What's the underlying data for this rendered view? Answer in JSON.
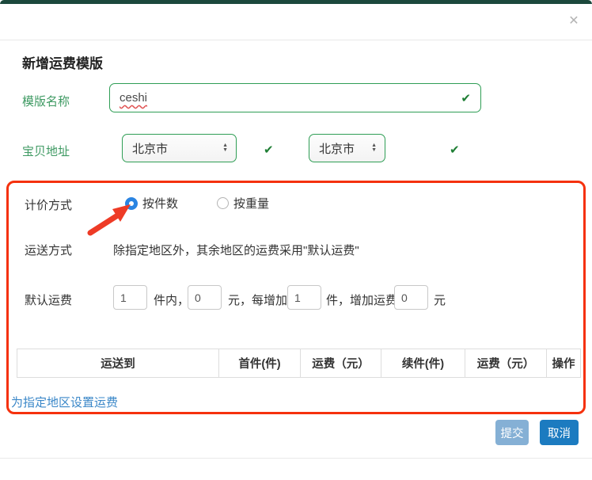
{
  "modal": {
    "title": "新增运费模版",
    "form": {
      "template_name": {
        "label": "模版名称",
        "value": "ceshi"
      },
      "item_address": {
        "label": "宝贝地址",
        "province": "北京市",
        "city": "北京市"
      },
      "pricing_method": {
        "label": "计价方式",
        "options": [
          {
            "label": "按件数",
            "selected": true
          },
          {
            "label": "按重量",
            "selected": false
          }
        ]
      },
      "shipping_method": {
        "label": "运送方式",
        "note": "除指定地区外，其余地区的运费采用\"默认运费\""
      },
      "default_fee": {
        "label": "默认运费",
        "within_count": "1",
        "t1": "件内，",
        "base_fee": "0",
        "t2": "元，每增加",
        "increment_count": "1",
        "t3": "件，增加运费",
        "increment_fee": "0",
        "t4": "元"
      }
    },
    "table": {
      "headers": [
        "运送到",
        "首件(件)",
        "运费（元）",
        "续件(件)",
        "运费（元）",
        "操作"
      ]
    },
    "set_region_link": "为指定地区设置运费",
    "footer": {
      "submit": "提交",
      "cancel": "取消"
    }
  },
  "icons": {
    "close": "✕",
    "check": "✔",
    "arrow_up": "▲",
    "arrow_down": "▼"
  },
  "colors": {
    "top_bar_green": "#1c483c",
    "label_green": "#3f9a63",
    "valid_border_green": "#2f9e55",
    "check_green": "#1e7e34",
    "highlight_red": "#f5310d",
    "annotation_arrow_red": "#ee3b26",
    "radio_blue": "#2a84e2",
    "link_blue": "#3a87c8",
    "submit_blue_disabled": "#85b0d5",
    "cancel_blue": "#1c7bc0"
  }
}
